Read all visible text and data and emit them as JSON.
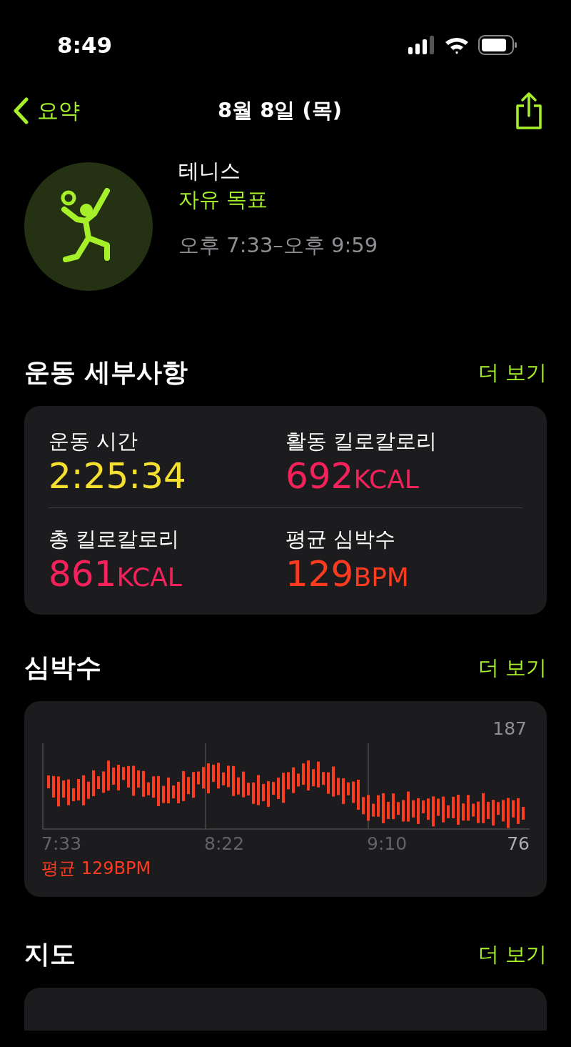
{
  "status_bar": {
    "time": "8:49"
  },
  "nav": {
    "back": "요약",
    "title": "8월 8일 (목)"
  },
  "workout": {
    "name": "테니스",
    "goal": "자유 목표",
    "time_range": "오후 7:33–오후 9:59"
  },
  "details": {
    "title": "운동 세부사항",
    "more": "더 보기",
    "stats": [
      {
        "label": "운동 시간",
        "value": "2:25:34",
        "color": "#f5e030"
      },
      {
        "label": "활동 킬로칼로리",
        "value": "692",
        "unit": "KCAL",
        "color": "#f5215a"
      },
      {
        "label": "총 킬로칼로리",
        "value": "861",
        "unit": "KCAL",
        "color": "#f5215a"
      },
      {
        "label": "평균 심박수",
        "value": "129",
        "unit": "BPM",
        "color": "#ff3b1f"
      }
    ]
  },
  "heart_rate": {
    "title": "심박수",
    "more": "더 보기",
    "max": "187",
    "min": "76",
    "times": [
      "7:33",
      "8:22",
      "9:10"
    ],
    "average": "평균 129BPM"
  },
  "map": {
    "title": "지도",
    "more": "더 보기"
  }
}
